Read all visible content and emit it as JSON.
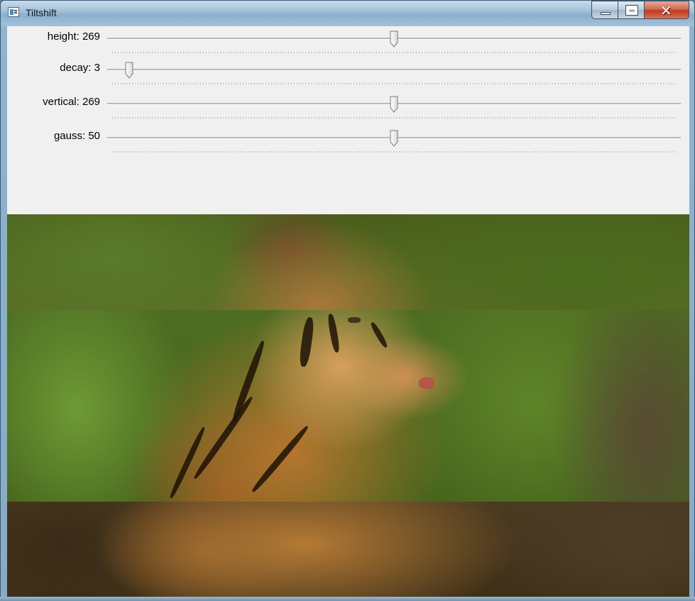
{
  "window": {
    "title": "Tiltshift",
    "icon": "app-window-icon",
    "controls": [
      "minimize-icon",
      "maximize-icon",
      "close-icon"
    ]
  },
  "sliders": [
    {
      "label": "height: 269",
      "value": 269,
      "position": 0.5
    },
    {
      "label": "decay: 3",
      "value": 3,
      "position": 0.038
    },
    {
      "label": "vertical: 269",
      "value": 269,
      "position": 0.5
    },
    {
      "label": "gauss: 50",
      "value": 50,
      "position": 0.5
    }
  ],
  "image": {
    "subject": "tiger-photo",
    "effect": "tilt-shift blur on top and bottom bands"
  }
}
